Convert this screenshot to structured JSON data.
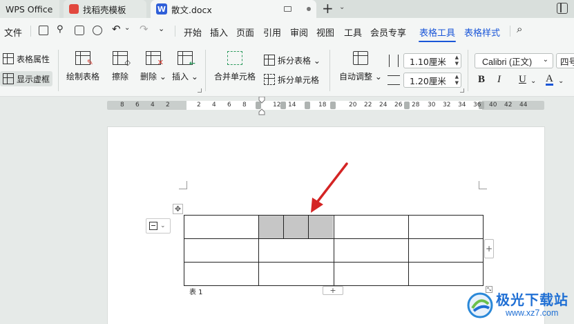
{
  "tabs": [
    {
      "label": "WPS Office"
    },
    {
      "label": "找稻壳模板"
    },
    {
      "label": "散文.docx",
      "badge": "W"
    }
  ],
  "menu": {
    "file": "文件",
    "items": [
      "开始",
      "插入",
      "页面",
      "引用",
      "审阅",
      "视图",
      "工具",
      "会员专享",
      "表格工具",
      "表格样式"
    ],
    "active": "表格工具"
  },
  "ribbon": {
    "table_props": "表格属性",
    "show_gridlines": "显示虚框",
    "draw_table": "绘制表格",
    "erase": "擦除",
    "delete": "删除",
    "insert": "插入",
    "merge_cells": "合并单元格",
    "split_table": "拆分表格",
    "split_cells": "拆分单元格",
    "auto_fit": "自动调整",
    "width_value": "1.10厘米",
    "height_value": "1.20厘米",
    "font_name": "Calibri (正文)",
    "font_size": "四号",
    "bold": "B",
    "italic": "I",
    "underline": "U",
    "font_color": "A"
  },
  "ruler": {
    "left_numbers": [
      "8",
      "6",
      "4",
      "2"
    ],
    "right_numbers": [
      "2",
      "4",
      "6",
      "8",
      "12",
      "14",
      "18",
      "20",
      "22",
      "24",
      "26",
      "28",
      "30",
      "32",
      "34",
      "36",
      "40",
      "42",
      "44"
    ]
  },
  "document": {
    "caption": "表 1",
    "table": {
      "rows": 3,
      "cols": 5,
      "split_cell": {
        "row": 0,
        "col": 1,
        "parts": 3
      }
    }
  },
  "watermark": {
    "name": "极光下载站",
    "url": "www.xz7.com"
  },
  "colors": {
    "accent": "#1a56d8",
    "arrow": "#d42424",
    "selected_cell": "#c6c6c6"
  }
}
